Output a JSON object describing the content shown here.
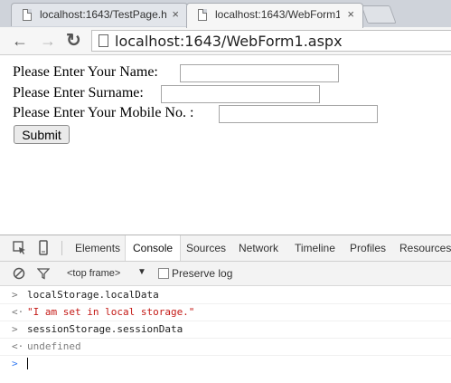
{
  "browser": {
    "tabs": [
      {
        "title": "localhost:1643/TestPage.h",
        "close": "×"
      },
      {
        "title": "localhost:1643/WebForm1",
        "close": "×"
      }
    ],
    "nav": {
      "back": "←",
      "forward": "→",
      "reload": "↻"
    },
    "url": "localhost:1643/WebForm1.aspx"
  },
  "form": {
    "name_label": "Please Enter Your Name:",
    "name_value": "",
    "surname_label": "Please Enter Surname:",
    "surname_value": "",
    "mobile_label": "Please Enter Your Mobile No. :",
    "mobile_value": "",
    "submit_label": "Submit"
  },
  "devtools": {
    "tabs": [
      "Elements",
      "Console",
      "Sources",
      "Network",
      "Timeline",
      "Profiles",
      "Resources"
    ],
    "active_tab": "Console",
    "frame_select": "<top frame>",
    "frame_arrow": "▼",
    "preserve_log": "Preserve log",
    "console": [
      {
        "prompt": ">",
        "text": "localStorage.localData",
        "color": "#222222"
      },
      {
        "prompt": "<·",
        "text": "\"I am set in local storage.\"",
        "color": "#c41a16"
      },
      {
        "prompt": ">",
        "text": "sessionStorage.sessionData",
        "color": "#222222"
      },
      {
        "prompt": "<·",
        "text": "undefined",
        "color": "#808080"
      }
    ],
    "input_prompt": ">",
    "prompt_color": "#367cf1"
  }
}
